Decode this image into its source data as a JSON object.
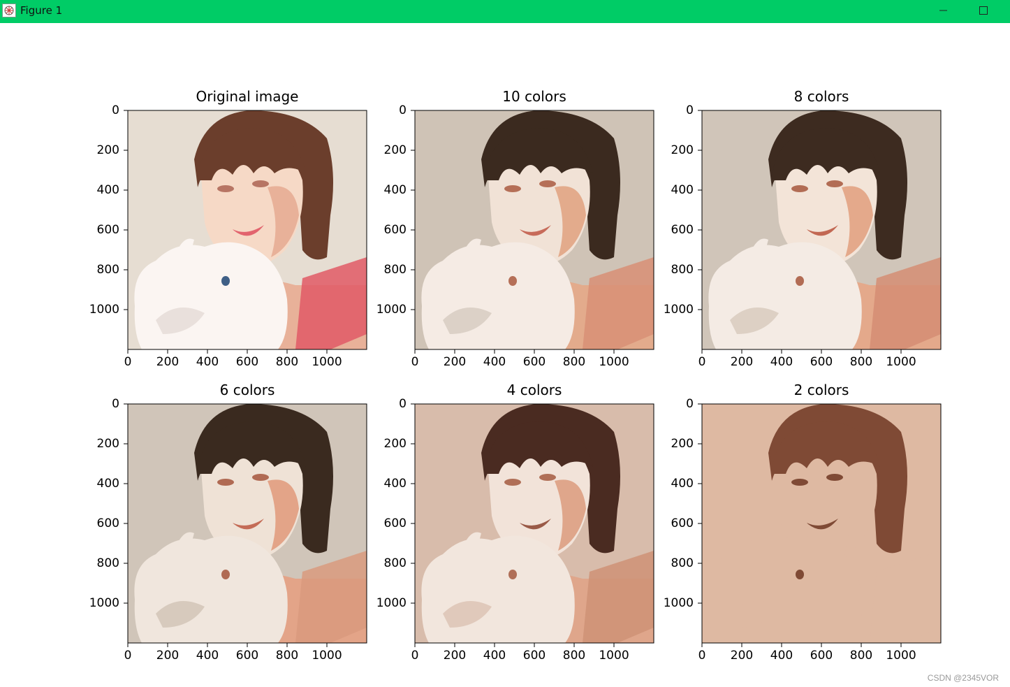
{
  "window": {
    "title": "Figure 1",
    "icon": "matplotlib-figure-icon",
    "controls": [
      "minimize-icon",
      "maximize-icon",
      "close-icon"
    ],
    "titlebar_color": "#00cc66"
  },
  "figure": {
    "panels": [
      {
        "title": "Original image",
        "image": "original portrait of woman holding white rabbit"
      },
      {
        "title": "10 colors",
        "image": "color-quantized portrait, 10 colors"
      },
      {
        "title": "8 colors",
        "image": "color-quantized portrait, 8 colors"
      },
      {
        "title": "6 colors",
        "image": "color-quantized portrait, 6 colors"
      },
      {
        "title": "4 colors",
        "image": "color-quantized portrait, 4 colors"
      },
      {
        "title": "2 colors",
        "image": "color-quantized portrait, 2 colors"
      }
    ],
    "y_ticks": [
      "0",
      "200",
      "400",
      "600",
      "800",
      "1000"
    ],
    "x_ticks": [
      "0",
      "200",
      "400",
      "600",
      "800",
      "1000"
    ]
  },
  "watermark": "CSDN @2345VOR"
}
